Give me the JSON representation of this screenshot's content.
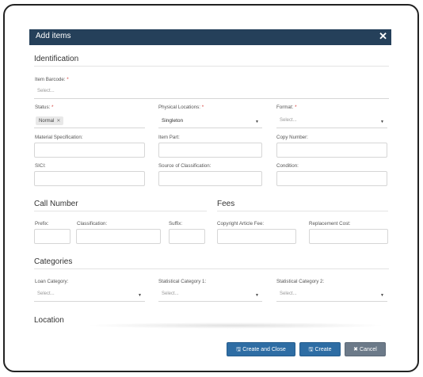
{
  "dialog": {
    "title": "Add items",
    "close_glyph": "✕"
  },
  "identification": {
    "title": "Identification",
    "item_barcode_label": "Item Barcode:",
    "item_barcode_placeholder": "Select...",
    "status_label": "Status:",
    "status_tag": "Normal",
    "tag_remove_glyph": "✕",
    "physical_locations_label": "Physical Locations:",
    "physical_locations_value": "Singleton",
    "format_label": "Format:",
    "format_placeholder": "Select...",
    "material_specification_label": "Material Specification:",
    "item_part_label": "Item Part:",
    "copy_number_label": "Copy Number:",
    "sici_label": "SICI:",
    "source_of_classification_label": "Source of Classification:",
    "condition_label": "Condition:",
    "required_mark": "*"
  },
  "call_number": {
    "title": "Call Number",
    "prefix_label": "Prefix:",
    "classification_label": "Classification:",
    "suffix_label": "Suffix:"
  },
  "fees": {
    "title": "Fees",
    "copyright_article_fee_label": "Copyright Article Fee:",
    "replacement_cost_label": "Replacement Cost:"
  },
  "categories": {
    "title": "Categories",
    "loan_category_label": "Loan Category:",
    "loan_category_placeholder": "Select...",
    "statistical_category_1_label": "Statistical Category 1:",
    "statistical_category_1_placeholder": "Select...",
    "statistical_category_2_label": "Statistical Category 2:",
    "statistical_category_2_placeholder": "Select..."
  },
  "location": {
    "title": "Location"
  },
  "icons": {
    "caret": "▼",
    "save": "🖫",
    "cancel": "✖"
  },
  "footer": {
    "create_and_close_label": "Create and Close",
    "create_label": "Create",
    "cancel_label": "Cancel"
  },
  "colors": {
    "titlebar": "#25405a",
    "primary_button": "#2e6da4",
    "cancel_button": "#6c7a89",
    "required": "#d43f3a"
  }
}
